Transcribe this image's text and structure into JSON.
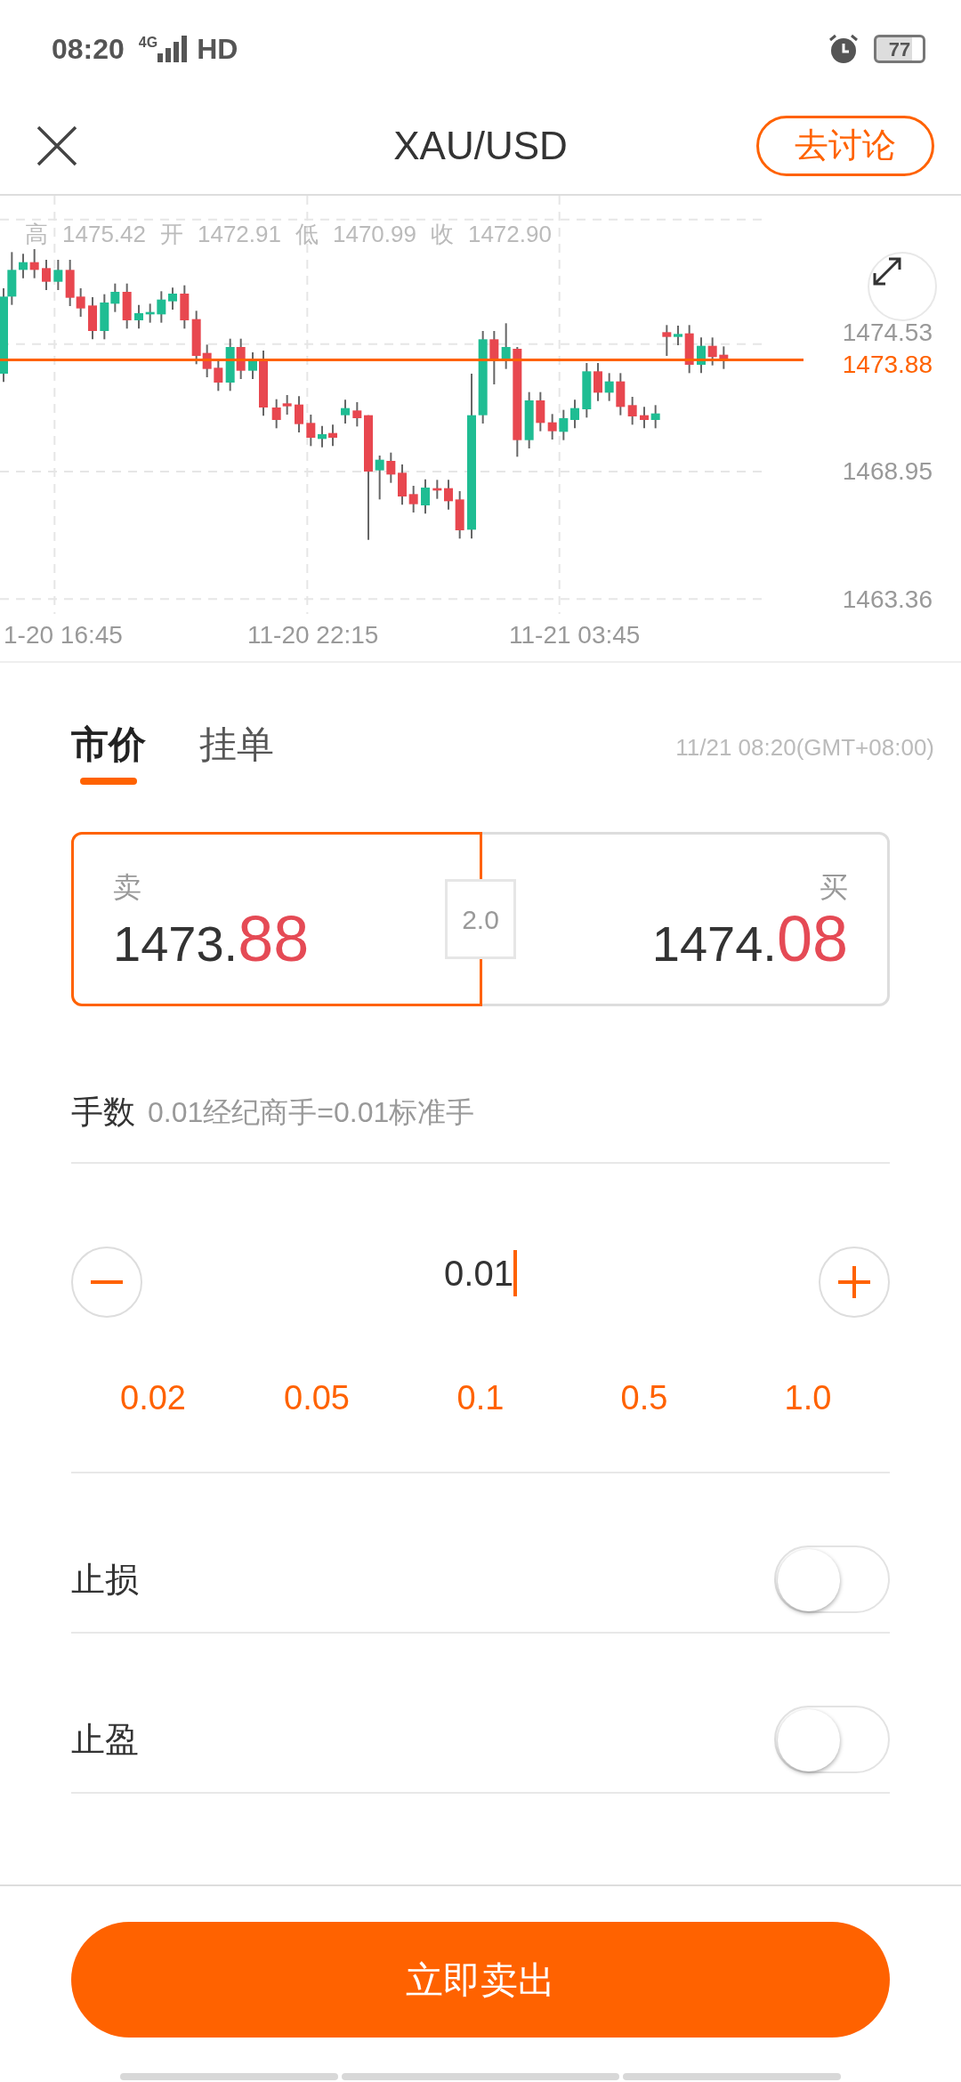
{
  "status_bar": {
    "time": "08:20",
    "network": "4G",
    "hd": "HD",
    "battery": "77"
  },
  "header": {
    "title": "XAU/USD",
    "action": "去讨论"
  },
  "chart": {
    "ohlc": [
      {
        "label": "高",
        "value": "1475.42"
      },
      {
        "label": "开",
        "value": "1472.91"
      },
      {
        "label": "低",
        "value": "1470.99"
      },
      {
        "label": "收",
        "value": "1472.90"
      }
    ],
    "y_labels": [
      "1474.53",
      "1468.95",
      "1463.36"
    ],
    "current_price": "1473.88",
    "x_labels": [
      "1-20 16:45",
      "11-20 22:15",
      "11-21 03:45"
    ]
  },
  "order_tabs": [
    {
      "label": "市价",
      "selected": true
    },
    {
      "label": "挂单",
      "selected": false
    }
  ],
  "timestamp": "11/21 08:20(GMT+08:00)",
  "quotes": [
    {
      "label": "卖",
      "main": "1473.",
      "pips": "88",
      "selected": true
    },
    {
      "label": "买",
      "main": "1474.",
      "pips": "08",
      "selected": false
    }
  ],
  "spread": "2.0",
  "lots": {
    "label": "手数",
    "hint": "0.01经纪商手=0.01标准手",
    "value": "0.01",
    "quick": [
      "0.02",
      "0.05",
      "0.1",
      "0.5",
      "1.0"
    ]
  },
  "options": [
    {
      "label": "止损",
      "on": false
    },
    {
      "label": "止盈",
      "on": false
    }
  ],
  "submit": "立即卖出"
}
